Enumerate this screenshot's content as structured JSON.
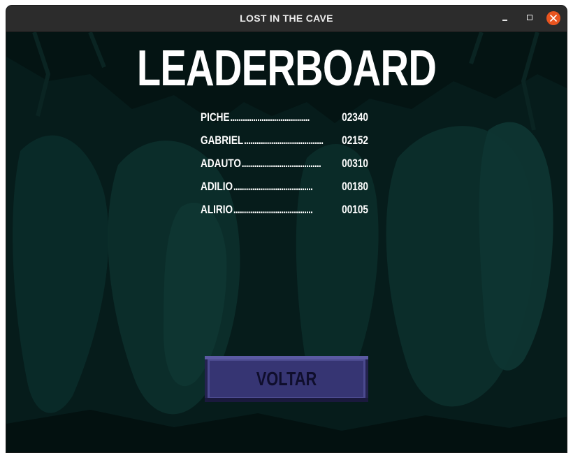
{
  "window": {
    "title": "LOST IN THE CAVE"
  },
  "screen": {
    "heading": "LEADERBOARD",
    "back_button": "VOLTAR"
  },
  "leaderboard": [
    {
      "name": "PICHE",
      "dots": "......................................",
      "score": "02340"
    },
    {
      "name": "GABRIEL",
      "dots": "......................................",
      "score": "02152"
    },
    {
      "name": "ADAUTO",
      "dots": "......................................",
      "score": "00310"
    },
    {
      "name": "ADILIO",
      "dots": "......................................",
      "score": "00180"
    },
    {
      "name": "ALIRIO",
      "dots": "......................................",
      "score": "00105"
    }
  ],
  "colors": {
    "background": "#041413",
    "cave_shape": "#0b2d2a",
    "button_fill": "#363573",
    "button_text": "#0f0e2c",
    "text": "#ffffff",
    "close_button": "#e9541f"
  }
}
